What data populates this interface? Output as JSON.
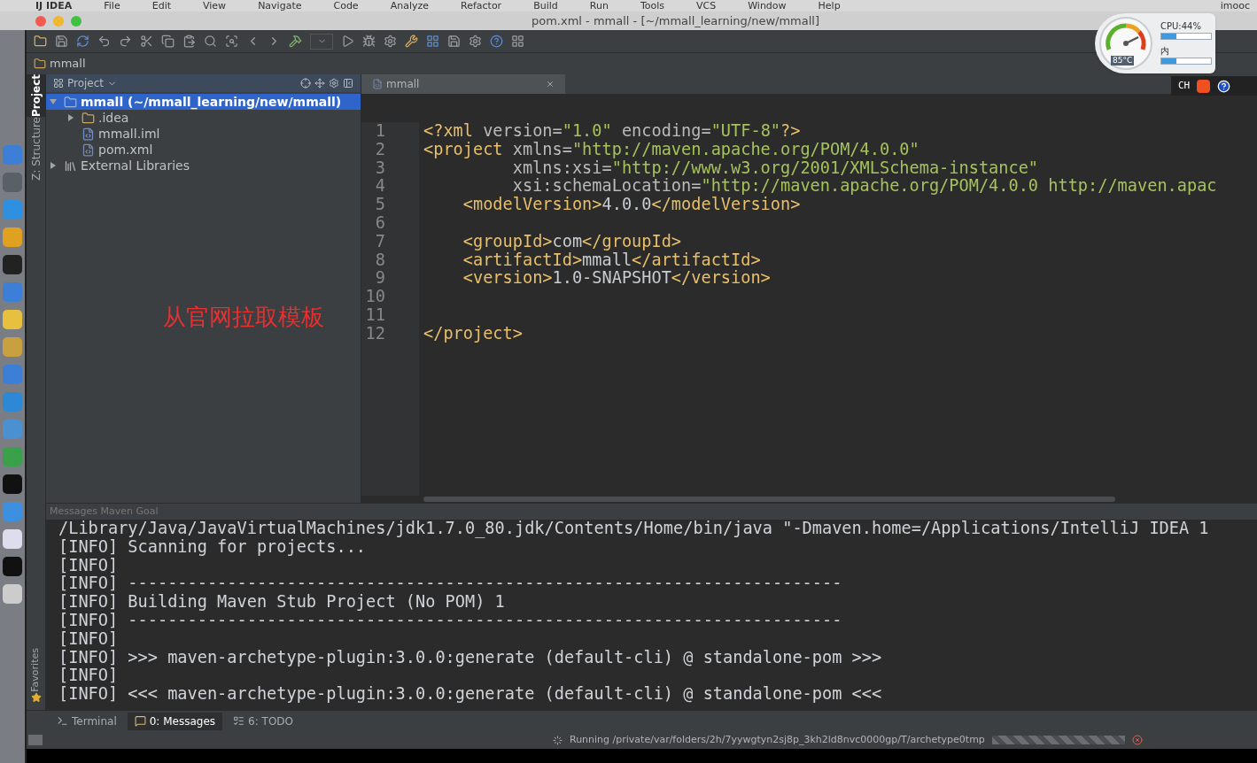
{
  "menu_bar": {
    "app": "IJ IDEA",
    "items": [
      "File",
      "Edit",
      "View",
      "Navigate",
      "Code",
      "Analyze",
      "Refactor",
      "Build",
      "Run",
      "Tools",
      "VCS",
      "Window",
      "Help"
    ],
    "user": "imooc"
  },
  "window": {
    "title": "pom.xml - mmall - [~/mmall_learning/new/mmall]"
  },
  "navigation_bar": {
    "crumb": "mmall"
  },
  "side_tabs": [
    {
      "label": "Project",
      "selected": true
    },
    {
      "label": "Z: Structure",
      "selected": false
    }
  ],
  "favorites_tab": {
    "label": "Favorites"
  },
  "project_panel": {
    "title": "Project",
    "tree": [
      {
        "kind": "project",
        "name": "mmall",
        "path": " (~/mmall_learning/new/mmall)",
        "selected": true,
        "expanded": true,
        "children": [
          {
            "kind": "folder",
            "name": ".idea",
            "selected": false,
            "expanded": false
          },
          {
            "kind": "module",
            "name": "mmall.iml",
            "selected": false
          },
          {
            "kind": "maven",
            "name": "pom.xml",
            "selected": false
          }
        ]
      },
      {
        "kind": "library",
        "name": "External Libraries",
        "selected": false,
        "expanded": false
      }
    ]
  },
  "caption": "从官网拉取模板",
  "editor": {
    "tab": "mmall",
    "lines": [
      {
        "number": "1",
        "segments": [
          {
            "kind": "tag",
            "text": "<?xml "
          },
          {
            "kind": "attr",
            "text": "version="
          },
          {
            "kind": "value",
            "text": "\"1.0\" "
          },
          {
            "kind": "attr",
            "text": "encoding="
          },
          {
            "kind": "value",
            "text": "\"UTF-8\""
          },
          {
            "kind": "tag",
            "text": "?>"
          }
        ]
      },
      {
        "number": "2",
        "segments": [
          {
            "kind": "tag",
            "text": "<project "
          },
          {
            "kind": "attr",
            "text": "xmlns="
          },
          {
            "kind": "value",
            "text": "\"http://maven.apache.org/POM/4.0.0\""
          }
        ]
      },
      {
        "number": "3",
        "kind": "attribute",
        "segments": [
          {
            "kind": "attr",
            "text": "xmlns:xsi="
          },
          {
            "kind": "value",
            "text": "\"http://www.w3.org/2001/XMLSchema-instance\""
          }
        ]
      },
      {
        "number": "4",
        "kind": "attribute",
        "segments": [
          {
            "kind": "attr",
            "text": "xsi:schemaLocation="
          },
          {
            "kind": "value",
            "text": "\"http://maven.apache.org/POM/4.0.0 http://maven.apac"
          }
        ]
      },
      {
        "number": "5",
        "kind": "child",
        "segments": [
          {
            "kind": "tag",
            "text": "<modelVersion>"
          },
          {
            "kind": "plain",
            "text": "4.0.0"
          },
          {
            "kind": "tag",
            "text": "</modelVersion>"
          }
        ]
      },
      {
        "number": "6"
      },
      {
        "number": "7",
        "kind": "child",
        "segments": [
          {
            "kind": "tag",
            "text": "<groupId>"
          },
          {
            "kind": "plain",
            "text": "com"
          },
          {
            "kind": "tag",
            "text": "</groupId>"
          }
        ]
      },
      {
        "number": "8",
        "kind": "child",
        "segments": [
          {
            "kind": "tag",
            "text": "<artifactId>"
          },
          {
            "kind": "plain",
            "text": "mmall"
          },
          {
            "kind": "tag",
            "text": "</artifactId>"
          }
        ]
      },
      {
        "number": "9",
        "kind": "child",
        "segments": [
          {
            "kind": "tag",
            "text": "<version>"
          },
          {
            "kind": "plain",
            "text": "1.0-SNAPSHOT"
          },
          {
            "kind": "tag",
            "text": "</version>"
          }
        ]
      },
      {
        "number": "10"
      },
      {
        "number": "11"
      },
      {
        "number": "12",
        "segments": [
          {
            "kind": "tag",
            "text": "</project>"
          }
        ]
      }
    ]
  },
  "messages_panel": {
    "title": "Messages Maven Goal",
    "lines": [
      "/Library/Java/JavaVirtualMachines/jdk1.7.0_80.jdk/Contents/Home/bin/java \"-Dmaven.home=/Applications/IntelliJ IDEA 1",
      "[INFO] Scanning for projects...",
      "[INFO]",
      "[INFO] ------------------------------------------------------------------------",
      "[INFO] Building Maven Stub Project (No POM) 1",
      "[INFO] ------------------------------------------------------------------------",
      "[INFO]",
      "[INFO] >>> maven-archetype-plugin:3.0.0:generate (default-cli) @ standalone-pom >>>",
      "[INFO]",
      "[INFO] <<< maven-archetype-plugin:3.0.0:generate (default-cli) @ standalone-pom <<<"
    ]
  },
  "tool_tabs": [
    {
      "kind": "terminal",
      "label": "Terminal",
      "selected": false
    },
    {
      "kind": "messages",
      "label": "0: Messages",
      "selected": true
    },
    {
      "kind": "todo",
      "label": "6: TODO",
      "selected": false
    }
  ],
  "status_bar": {
    "text": "Running /private/var/folders/2h/7yywgtyn2sj8p_3kh2ld8nvc0000gp/T/archetype0tmp",
    "progress": {
      "level": 1
    }
  },
  "monitor_widget": {
    "temperature": "85°C",
    "cpu": {
      "label": "CPU:44%",
      "level": 0.3
    },
    "memory": {
      "label": "内",
      "level": 0.3
    }
  },
  "ime_bar": {
    "label": "CH"
  }
}
